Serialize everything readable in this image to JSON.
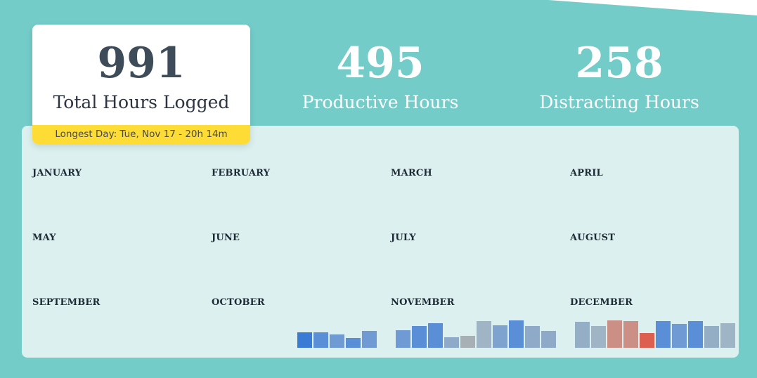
{
  "stats": {
    "total": {
      "value": "991",
      "label": "Total Hours Logged",
      "longest_day": "Longest Day: Tue, Nov 17 - 20h 14m"
    },
    "productive": {
      "value": "495",
      "label": "Productive Hours"
    },
    "distracting": {
      "value": "258",
      "label": "Distracting Hours"
    }
  },
  "months": [
    {
      "name": "JANUARY",
      "bars": []
    },
    {
      "name": "FEBRUARY",
      "bars": []
    },
    {
      "name": "MARCH",
      "bars": []
    },
    {
      "name": "APRIL",
      "bars": []
    },
    {
      "name": "MAY",
      "bars": []
    },
    {
      "name": "JUNE",
      "bars": []
    },
    {
      "name": "JULY",
      "bars": []
    },
    {
      "name": "AUGUST",
      "bars": []
    },
    {
      "name": "SEPTEMBER",
      "bars": []
    },
    {
      "name": "OCTOBER",
      "bars": [
        {
          "value": 22,
          "color": "#3a7bd5"
        },
        {
          "value": 22,
          "color": "#5a8fd8"
        },
        {
          "value": 19,
          "color": "#6f9ad4"
        },
        {
          "value": 14,
          "color": "#5a8fd8"
        },
        {
          "value": 24,
          "color": "#6f9ad4"
        }
      ]
    },
    {
      "name": "NOVEMBER",
      "bars": [
        {
          "value": 25,
          "color": "#6f9ad4"
        },
        {
          "value": 31,
          "color": "#5a8fd8"
        },
        {
          "value": 35,
          "color": "#5a8fd8"
        },
        {
          "value": 15,
          "color": "#8fa9c8"
        },
        {
          "value": 17,
          "color": "#a7b0b5"
        },
        {
          "value": 38,
          "color": "#9fb5c6"
        },
        {
          "value": 32,
          "color": "#7ea3cf"
        },
        {
          "value": 39,
          "color": "#5a8fd8"
        },
        {
          "value": 31,
          "color": "#8fa9c8"
        },
        {
          "value": 24,
          "color": "#8fa9c8"
        }
      ]
    },
    {
      "name": "DECEMBER",
      "bars": [
        {
          "value": 37,
          "color": "#94aec5"
        },
        {
          "value": 31,
          "color": "#9fb5c6"
        },
        {
          "value": 39,
          "color": "#cc8f86"
        },
        {
          "value": 38,
          "color": "#cc8f86"
        },
        {
          "value": 21,
          "color": "#dd5f4f"
        },
        {
          "value": 38,
          "color": "#5a8fd8"
        },
        {
          "value": 34,
          "color": "#6f9ad4"
        },
        {
          "value": 38,
          "color": "#5a8fd8"
        },
        {
          "value": 31,
          "color": "#94aec5"
        },
        {
          "value": 35,
          "color": "#9fb5c6"
        }
      ]
    }
  ]
}
